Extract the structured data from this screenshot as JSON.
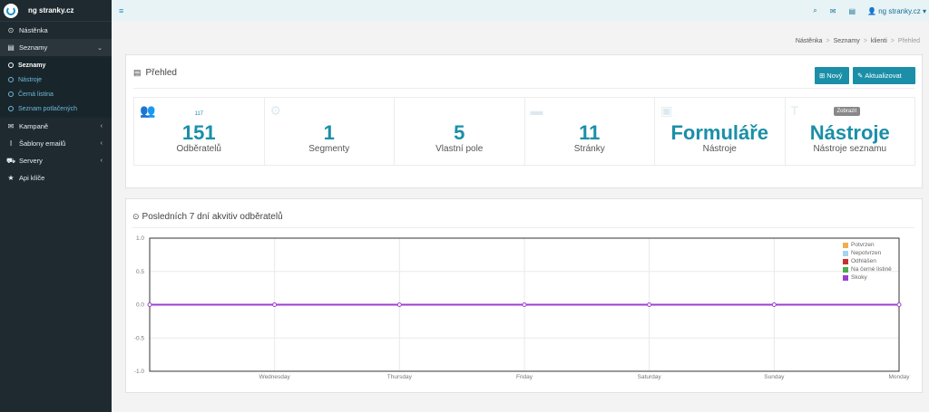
{
  "brand": {
    "name": "ng stranky.cz"
  },
  "sidebar": {
    "items": [
      {
        "label": "Nástěnka",
        "icon": "dashboard-icon"
      },
      {
        "label": "Seznamy",
        "icon": "list-icon",
        "active": true,
        "children": [
          {
            "label": "Seznamy",
            "active": true
          },
          {
            "label": "Nástroje"
          },
          {
            "label": "Černá listina"
          },
          {
            "label": "Seznam potlačených"
          }
        ]
      },
      {
        "label": "Kampaně",
        "icon": "envelope-icon"
      },
      {
        "label": "Šablony emailů",
        "icon": "template-icon"
      },
      {
        "label": "Servery",
        "icon": "truck-icon"
      },
      {
        "label": "Api klíče",
        "icon": "star-icon"
      }
    ]
  },
  "topbar": {
    "user": "ng stranky.cz"
  },
  "breadcrumb": [
    "Nástěnka",
    "Seznamy",
    "klienti",
    "Přehled"
  ],
  "overview": {
    "title": "Přehled",
    "btn_new": "Nový",
    "btn_update": "Aktualizovat",
    "tooltip": "Zobrazit",
    "stats": [
      {
        "small": "117",
        "value": "151",
        "label": "Odběratelů"
      },
      {
        "small": "",
        "value": "1",
        "label": "Segmenty"
      },
      {
        "small": "",
        "value": "5",
        "label": "Vlastní pole"
      },
      {
        "small": "",
        "value": "11",
        "label": "Stránky"
      },
      {
        "small": "",
        "value": "Formuláře",
        "label": "Nástroje"
      },
      {
        "small": "",
        "value": "Nástroje",
        "label": "Nástroje seznamu"
      }
    ]
  },
  "activity": {
    "title": "Posledních 7 dní akvitiv odběratelů"
  },
  "chart_data": {
    "type": "line",
    "title": "Posledních 7 dní akvitiv odběratelů",
    "x": [
      "",
      "Wednesday",
      "Thursday",
      "Friday",
      "Saturday",
      "Sunday",
      "Monday"
    ],
    "ylim": [
      -1.0,
      1.0
    ],
    "yticks": [
      "1.0",
      "0.5",
      "0.0",
      "-0.5",
      "-1.0"
    ],
    "grid": true,
    "legend_position": "top-right",
    "series": [
      {
        "name": "Potvrzen",
        "color": "#f0ad4e",
        "values": [
          0,
          0,
          0,
          0,
          0,
          0,
          0
        ]
      },
      {
        "name": "Nepotvrzen",
        "color": "#a6d3f0",
        "values": [
          0,
          0,
          0,
          0,
          0,
          0,
          0
        ]
      },
      {
        "name": "Odhlášen",
        "color": "#c9302c",
        "values": [
          0,
          0,
          0,
          0,
          0,
          0,
          0
        ]
      },
      {
        "name": "Na černé listině",
        "color": "#4cae4c",
        "values": [
          0,
          0,
          0,
          0,
          0,
          0,
          0
        ]
      },
      {
        "name": "Skoky",
        "color": "#9b3fd1",
        "values": [
          0,
          0,
          0,
          0,
          0,
          0,
          0
        ]
      }
    ]
  }
}
